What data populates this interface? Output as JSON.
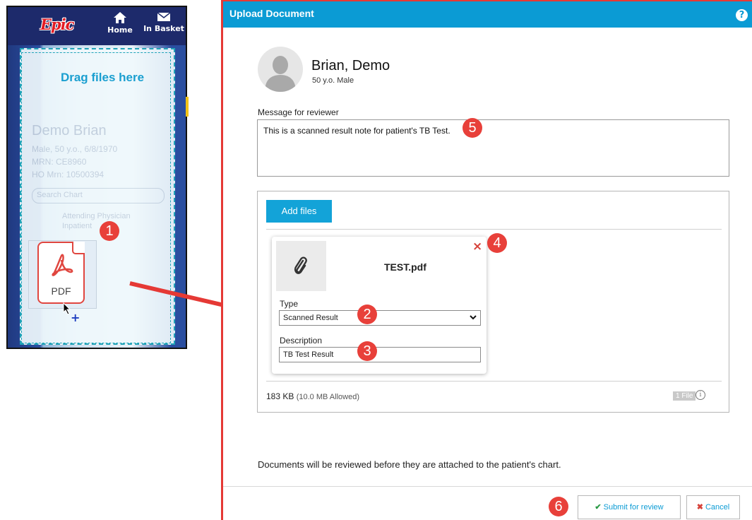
{
  "epic": {
    "logo": "Epic",
    "nav": {
      "home": "Home",
      "in_basket": "In Basket"
    },
    "drag_label": "Drag files here",
    "ghost": {
      "name": "Demo Brian",
      "line1": "Male, 50 y.o., 6/8/1970",
      "line2": "MRN: CE8960",
      "line3": "HO Mrn: 10500394",
      "search": "Search Chart",
      "attending": "Attending Physician",
      "inpatient": "Inpatient"
    },
    "pdf_label": "PDF"
  },
  "badges": {
    "b1": "1",
    "b2": "2",
    "b3": "3",
    "b4": "4",
    "b5": "5",
    "b6": "6"
  },
  "dialog": {
    "title": "Upload Document",
    "help": "?",
    "patient": {
      "name": "Brian, Demo",
      "info": "50 y.o. Male"
    },
    "message_label": "Message for reviewer",
    "message_value": "This is a scanned result note for patient's TB Test.",
    "add_files": "Add files",
    "file": {
      "name": "TEST.pdf",
      "remove": "×",
      "type_label": "Type",
      "type_value": "Scanned Result",
      "description_label": "Description",
      "description_value": "TB Test Result"
    },
    "size": "183 KB",
    "allowed": "(10.0 MB Allowed)",
    "file_count": "1 File",
    "info": "i",
    "review_note": "Documents will be reviewed before they are attached to the patient's chart.",
    "submit": "Submit for review",
    "cancel": "Cancel"
  },
  "colors": {
    "header_blue": "#0b9bd4",
    "badge_red": "#e8403a",
    "epic_navy": "#1d2a6b",
    "accent_red": "#e53935"
  }
}
